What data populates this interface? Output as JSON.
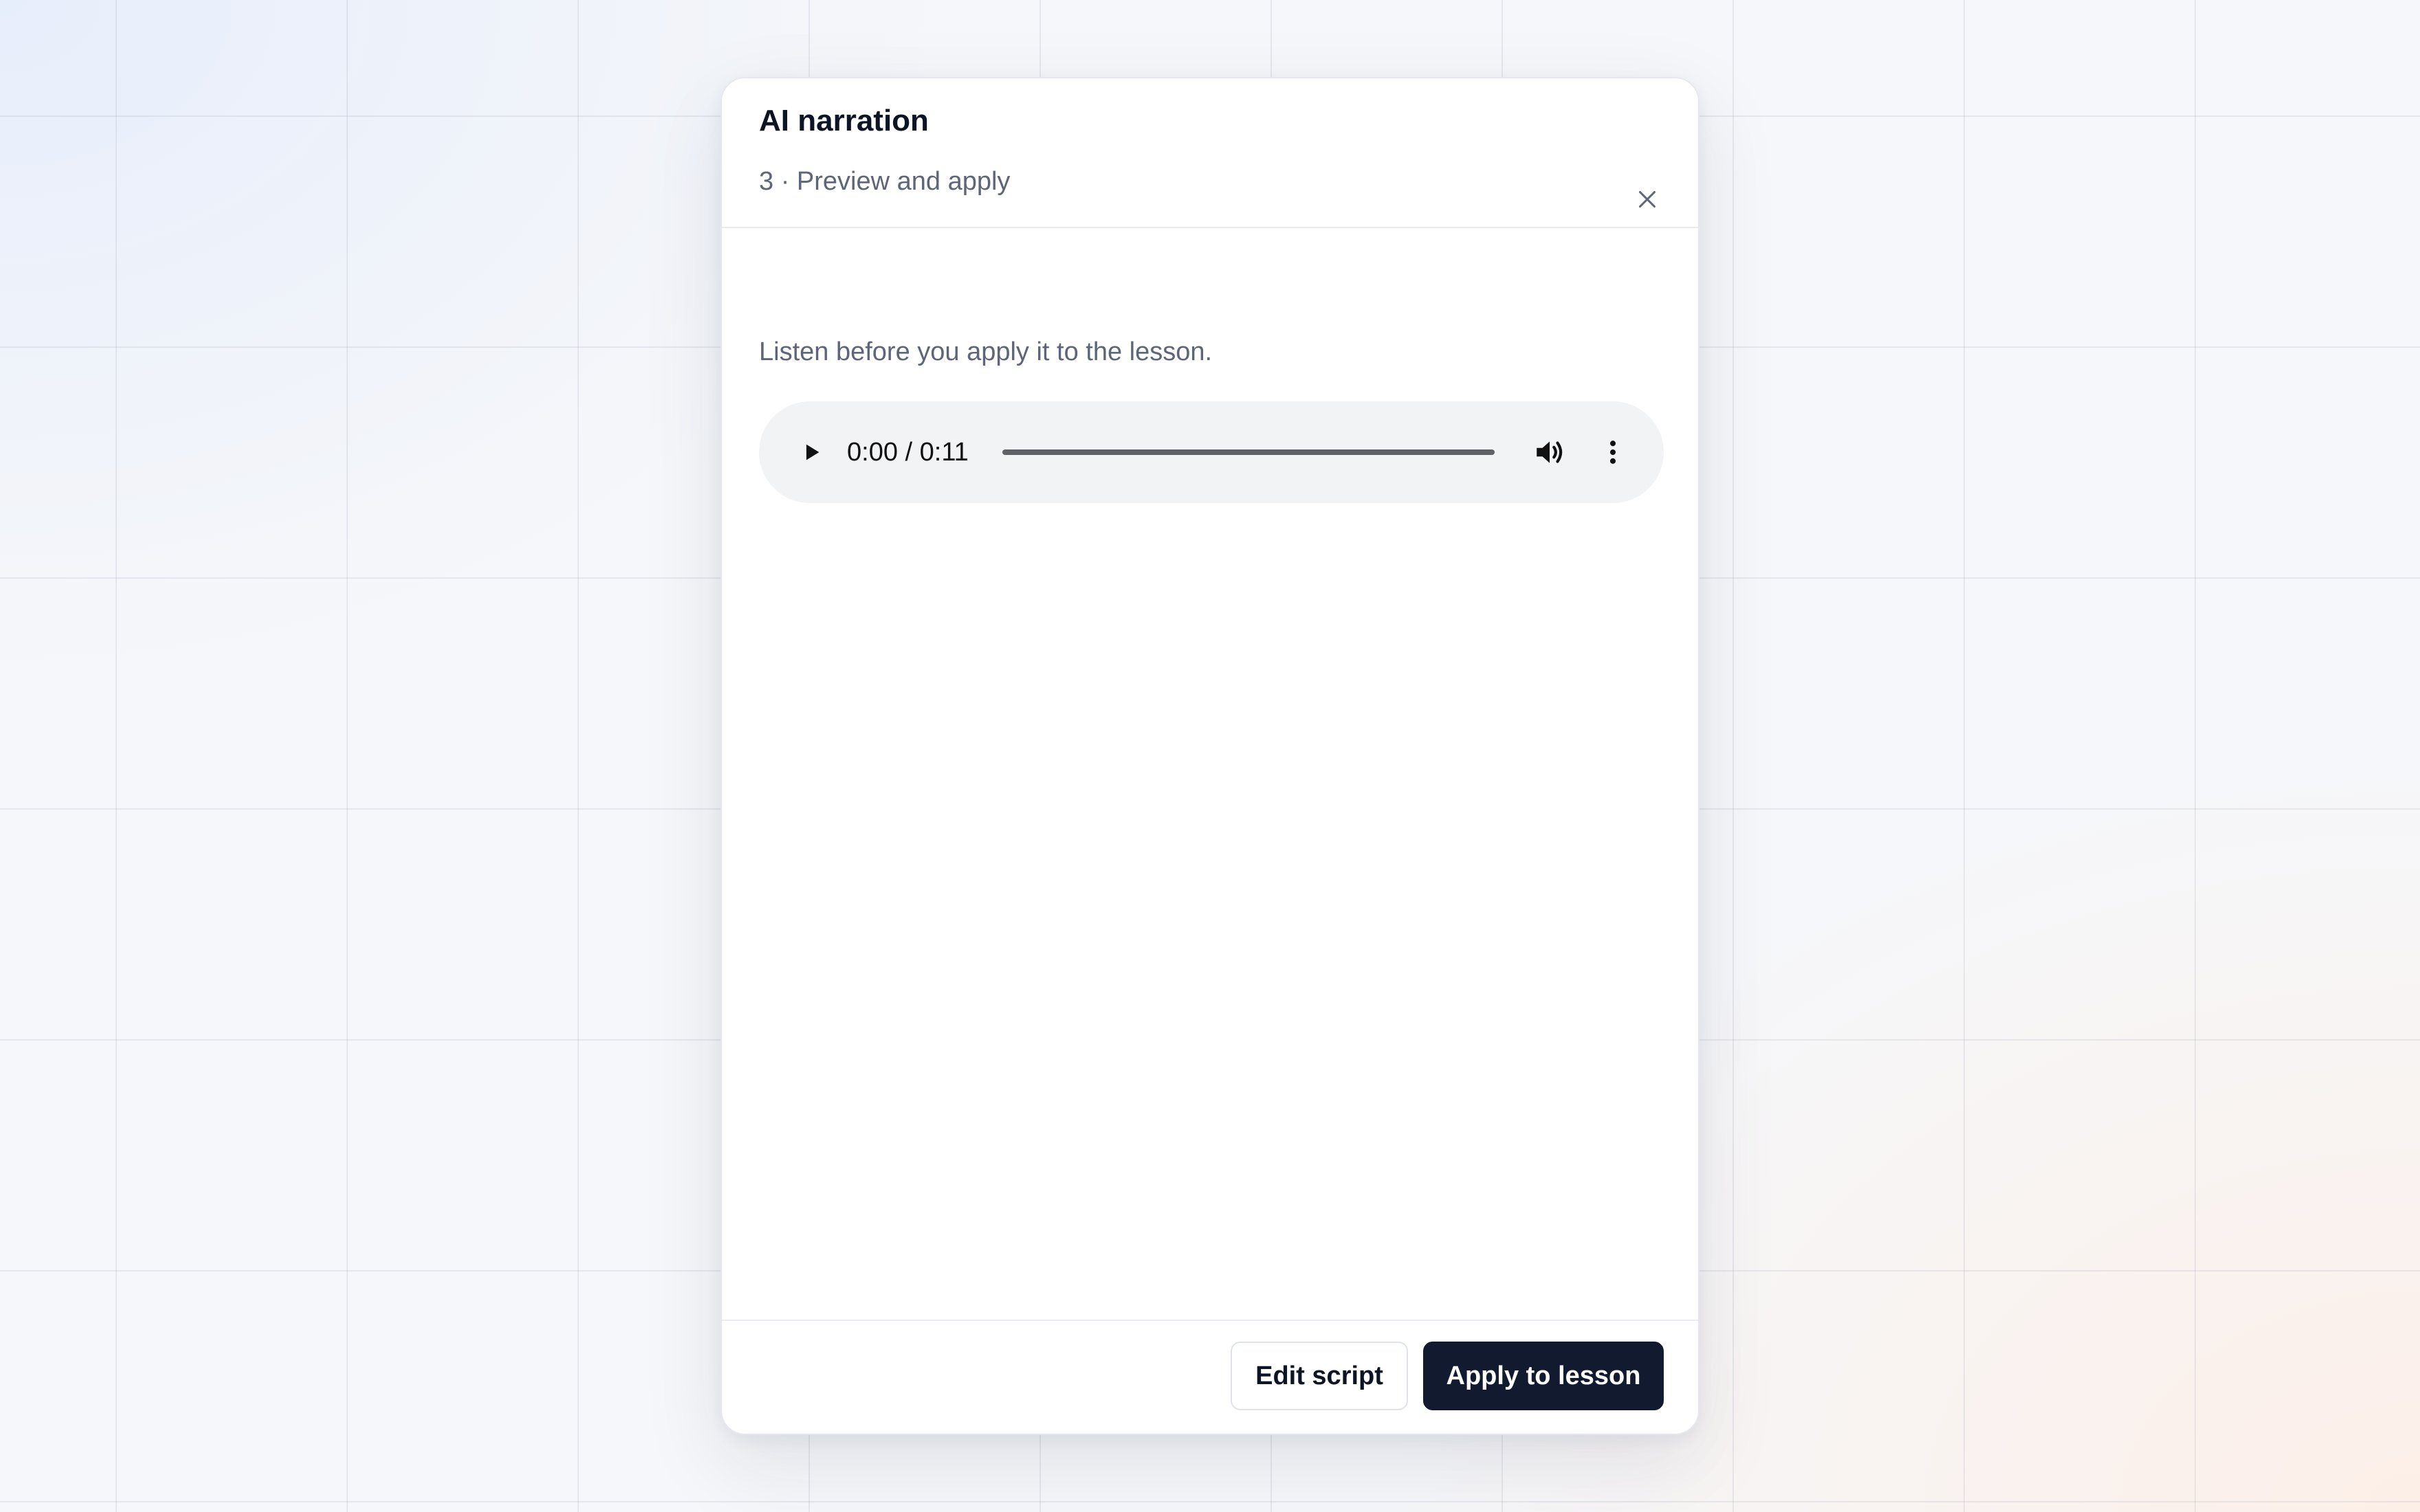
{
  "dialog": {
    "title": "AI narration",
    "subtitle": "3 · Preview and apply",
    "close_icon": "close-icon"
  },
  "body": {
    "instruction": "Listen before you apply it to the lesson."
  },
  "audio": {
    "time_readout": "0:00 / 0:11",
    "current_time": "0:00",
    "duration": "0:11",
    "progress_fraction": 0,
    "icons": {
      "play": "play-icon",
      "volume": "volume-icon",
      "more": "more-vertical-icon"
    }
  },
  "footer": {
    "secondary_label": "Edit script",
    "primary_label": "Apply to lesson"
  },
  "colors": {
    "primary_button": "#111a2e",
    "player_background": "#f1f3f4"
  }
}
